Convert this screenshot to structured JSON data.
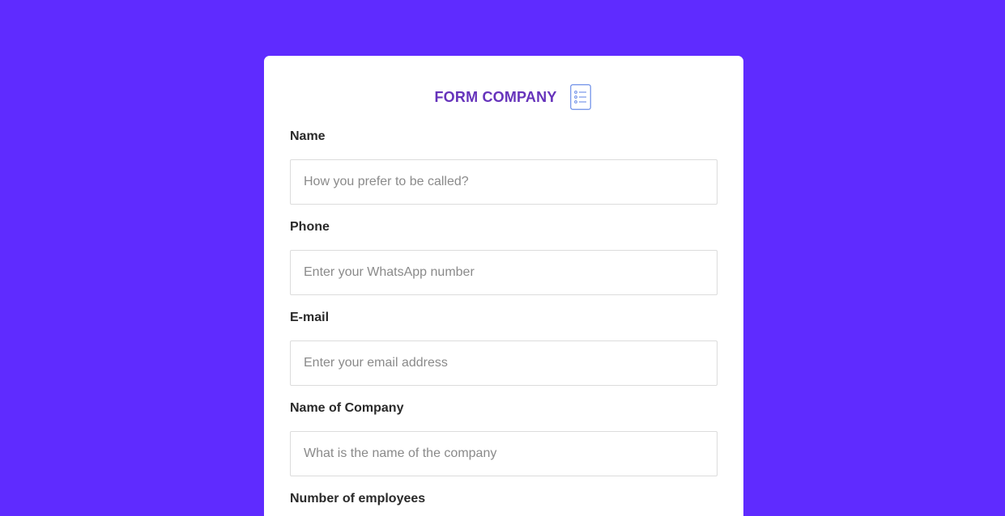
{
  "form": {
    "title": "FORM COMPANY",
    "icon": "list-form-icon",
    "fields": [
      {
        "label": "Name",
        "placeholder": "How you prefer to be called?",
        "value": ""
      },
      {
        "label": "Phone",
        "placeholder": "Enter your WhatsApp number",
        "value": ""
      },
      {
        "label": "E-mail",
        "placeholder": "Enter your email address",
        "value": ""
      },
      {
        "label": "Name of Company",
        "placeholder": "What is the name of the company",
        "value": ""
      },
      {
        "label": "Number of employees"
      }
    ]
  },
  "colors": {
    "background": "#5f2bff",
    "card": "#ffffff",
    "title": "#6633bb",
    "icon": "#6b8de8",
    "label": "#2a2a2a",
    "input_border": "#dcdcdc",
    "placeholder": "#8a8a8a"
  }
}
